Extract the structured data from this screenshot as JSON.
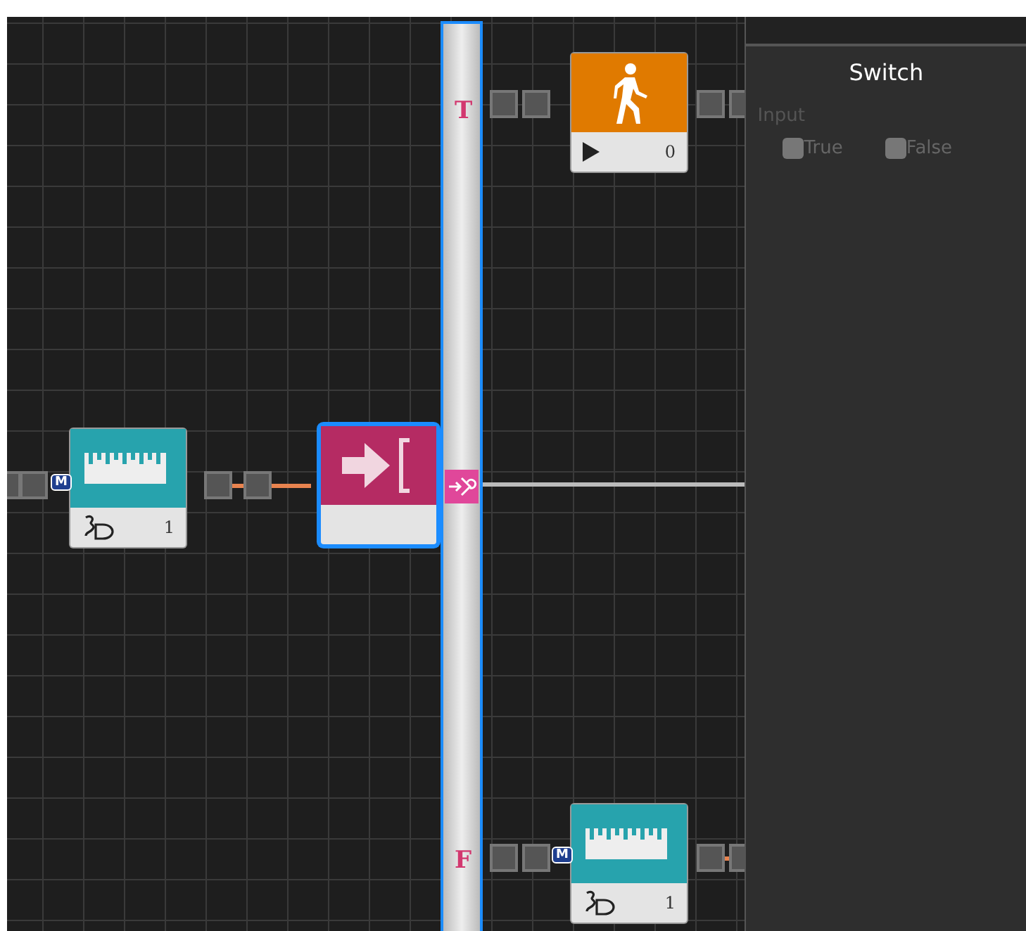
{
  "switch": {
    "branches": [
      {
        "label": "T"
      },
      {
        "label": "F"
      }
    ]
  },
  "nodes": [
    {
      "kind": "distance",
      "value": "1",
      "port": "M",
      "selected": false
    },
    {
      "kind": "action",
      "selected": true
    },
    {
      "kind": "walk",
      "value": "0",
      "selected": false
    },
    {
      "kind": "distance",
      "value": "1",
      "port": "M",
      "selected": false
    }
  ],
  "panel": {
    "title": "Switch",
    "section": "Input",
    "options": [
      {
        "label": "True",
        "checked": false,
        "disabled": true
      },
      {
        "label": "False",
        "checked": false,
        "disabled": true
      }
    ]
  }
}
